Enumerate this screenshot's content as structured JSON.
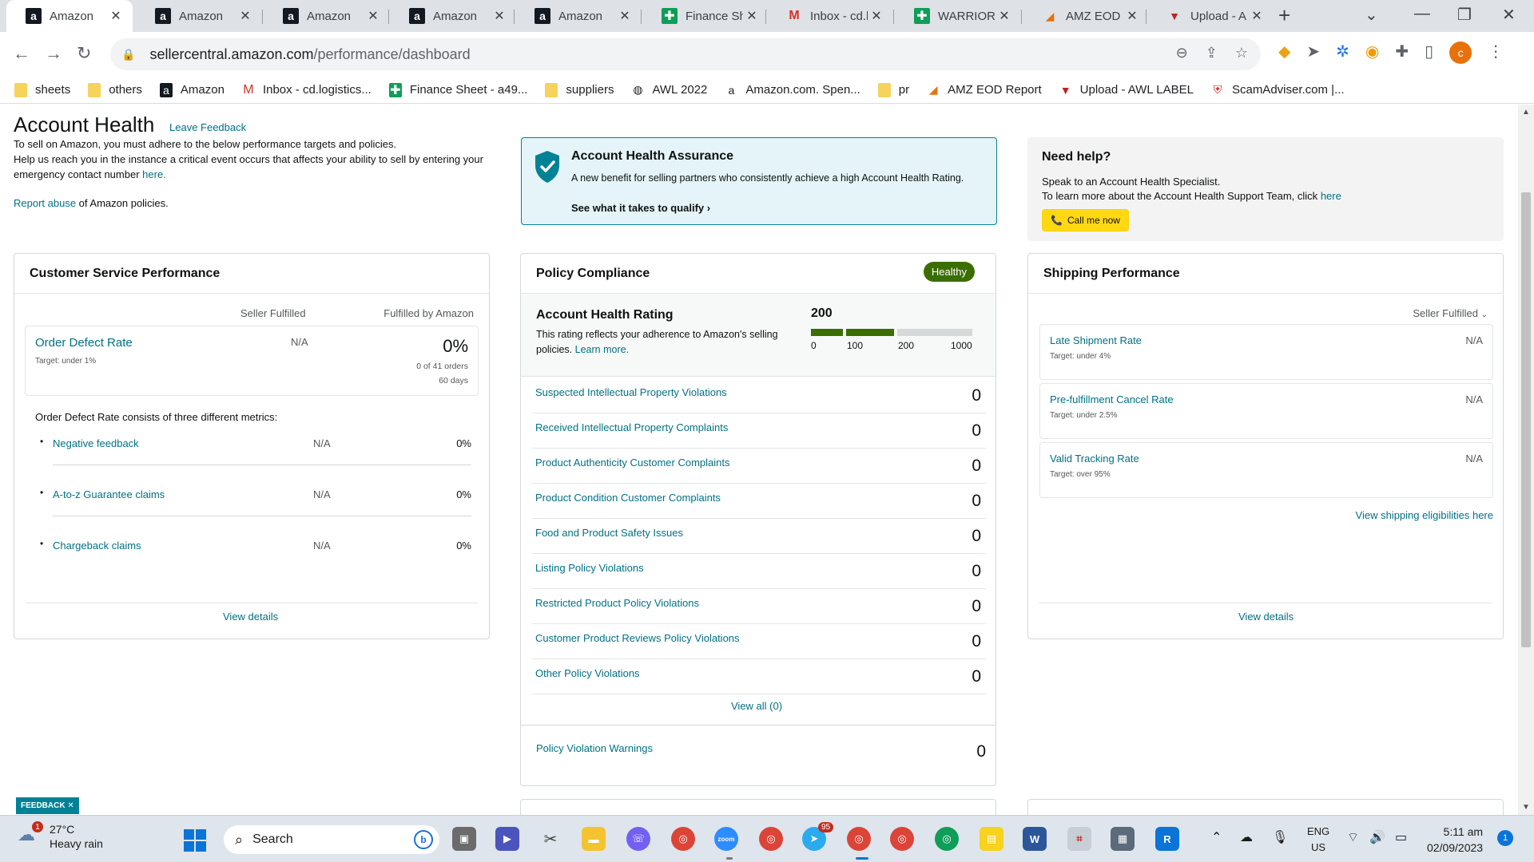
{
  "browser": {
    "tabs": [
      {
        "title": "Amazon",
        "icon": "amazon-icon",
        "active": true
      },
      {
        "title": "Amazon",
        "icon": "amazon-icon"
      },
      {
        "title": "Amazon",
        "icon": "amazon-icon"
      },
      {
        "title": "Amazon",
        "icon": "amazon-icon"
      },
      {
        "title": "Amazon",
        "icon": "amazon-icon"
      },
      {
        "title": "Finance She",
        "icon": "sheets-icon"
      },
      {
        "title": "Inbox - cd.l",
        "icon": "gmail-icon"
      },
      {
        "title": "WARRIORS",
        "icon": "sheets-icon"
      },
      {
        "title": "AMZ EOD R",
        "icon": "eod-icon"
      },
      {
        "title": "Upload - A",
        "icon": "upload-icon"
      }
    ],
    "url_host": "sellercentral.amazon.com",
    "url_path": "/performance/dashboard",
    "profile_initial": "c",
    "bookmarks": [
      {
        "label": "sheets",
        "icon": "folder-icon"
      },
      {
        "label": "others",
        "icon": "folder-icon"
      },
      {
        "label": "Amazon",
        "icon": "amazon-icon"
      },
      {
        "label": "Inbox - cd.logistics...",
        "icon": "gmail-icon"
      },
      {
        "label": "Finance Sheet - a49...",
        "icon": "sheets-icon"
      },
      {
        "label": "suppliers",
        "icon": "folder-icon"
      },
      {
        "label": "AWL 2022",
        "icon": "globe-icon"
      },
      {
        "label": "Amazon.com. Spen...",
        "icon": "amazon-a-icon"
      },
      {
        "label": "pr",
        "icon": "folder-icon"
      },
      {
        "label": "AMZ EOD Report",
        "icon": "eod-icon"
      },
      {
        "label": "Upload - AWL LABEL",
        "icon": "upload-icon"
      },
      {
        "label": "ScamAdviser.com |...",
        "icon": "shield-icon"
      }
    ]
  },
  "header": {
    "title": "Account Health",
    "feedback_link": "Leave Feedback",
    "intro_line1": "To sell on Amazon, you must adhere to the below performance targets and policies.",
    "intro_line2": "Help us reach you in the instance a critical event occurs that affects your ability to sell by entering your emergency contact number",
    "intro_here": "here.",
    "report_link": "Report abuse",
    "report_rest": " of Amazon policies."
  },
  "assurance": {
    "title": "Account Health Assurance",
    "desc": "A new benefit for selling partners who consistently achieve a high Account Health Rating.",
    "cta": "See what it takes to qualify"
  },
  "help": {
    "title": "Need help?",
    "line1": "Speak to an Account Health Specialist.",
    "line2": "To learn more about the Account Health Support Team, click",
    "line2_link": "here",
    "button": "Call me now"
  },
  "customer_service": {
    "title": "Customer Service Performance",
    "col_seller": "Seller Fulfilled",
    "col_fba": "Fulfilled by Amazon",
    "odr_label": "Order Defect Rate",
    "odr_target": "Target: under 1%",
    "odr_seller": "N/A",
    "odr_fba": "0%",
    "odr_orders": "0 of 41 orders",
    "odr_days": "60 days",
    "metrics_intro": "Order Defect Rate consists of three different metrics:",
    "metrics": [
      {
        "label": "Negative feedback",
        "seller": "N/A",
        "fba": "0%"
      },
      {
        "label": "A-to-z Guarantee claims",
        "seller": "N/A",
        "fba": "0%"
      },
      {
        "label": "Chargeback claims",
        "seller": "N/A",
        "fba": "0%"
      }
    ],
    "view_details": "View details"
  },
  "policy": {
    "title": "Policy Compliance",
    "status": "Healthy",
    "status_color": "#3b6e00",
    "ahr_title": "Account Health Rating",
    "ahr_desc": "This rating reflects your adherence to Amazon's selling policies.",
    "ahr_learn": "Learn more.",
    "ahr_value": "200",
    "ahr_fraction": 0.2,
    "ahr_ticks": [
      "0",
      "100",
      "200",
      "1000"
    ],
    "rows": [
      {
        "label": "Suspected Intellectual Property Violations",
        "count": "0"
      },
      {
        "label": "Received Intellectual Property Complaints",
        "count": "0"
      },
      {
        "label": "Product Authenticity Customer Complaints",
        "count": "0"
      },
      {
        "label": "Product Condition Customer Complaints",
        "count": "0"
      },
      {
        "label": "Food and Product Safety Issues",
        "count": "0"
      },
      {
        "label": "Listing Policy Violations",
        "count": "0"
      },
      {
        "label": "Restricted Product Policy Violations",
        "count": "0"
      },
      {
        "label": "Customer Product Reviews Policy Violations",
        "count": "0"
      },
      {
        "label": "Other Policy Violations",
        "count": "0"
      }
    ],
    "view_all": "View all (0)",
    "warnings_label": "Policy Violation Warnings",
    "warnings_count": "0"
  },
  "shipping": {
    "title": "Shipping Performance",
    "filter": "Seller Fulfilled",
    "metrics": [
      {
        "label": "Late Shipment Rate",
        "target": "Target: under 4%",
        "value": "N/A"
      },
      {
        "label": "Pre-fulfillment Cancel Rate",
        "target": "Target: under 2.5%",
        "value": "N/A"
      },
      {
        "label": "Valid Tracking Rate",
        "target": "Target: over 95%",
        "value": "N/A"
      }
    ],
    "eligibility_link": "View shipping eligibilities here",
    "view_details": "View details"
  },
  "feedback_tag": "FEEDBACK",
  "taskbar": {
    "weather_temp": "27°C",
    "weather_desc": "Heavy rain",
    "weather_badge": "1",
    "search_placeholder": "Search",
    "telegram_badge": "95",
    "lang_line1": "ENG",
    "lang_line2": "US",
    "time": "5:11 am",
    "date": "02/09/2023",
    "notifications": "1"
  }
}
